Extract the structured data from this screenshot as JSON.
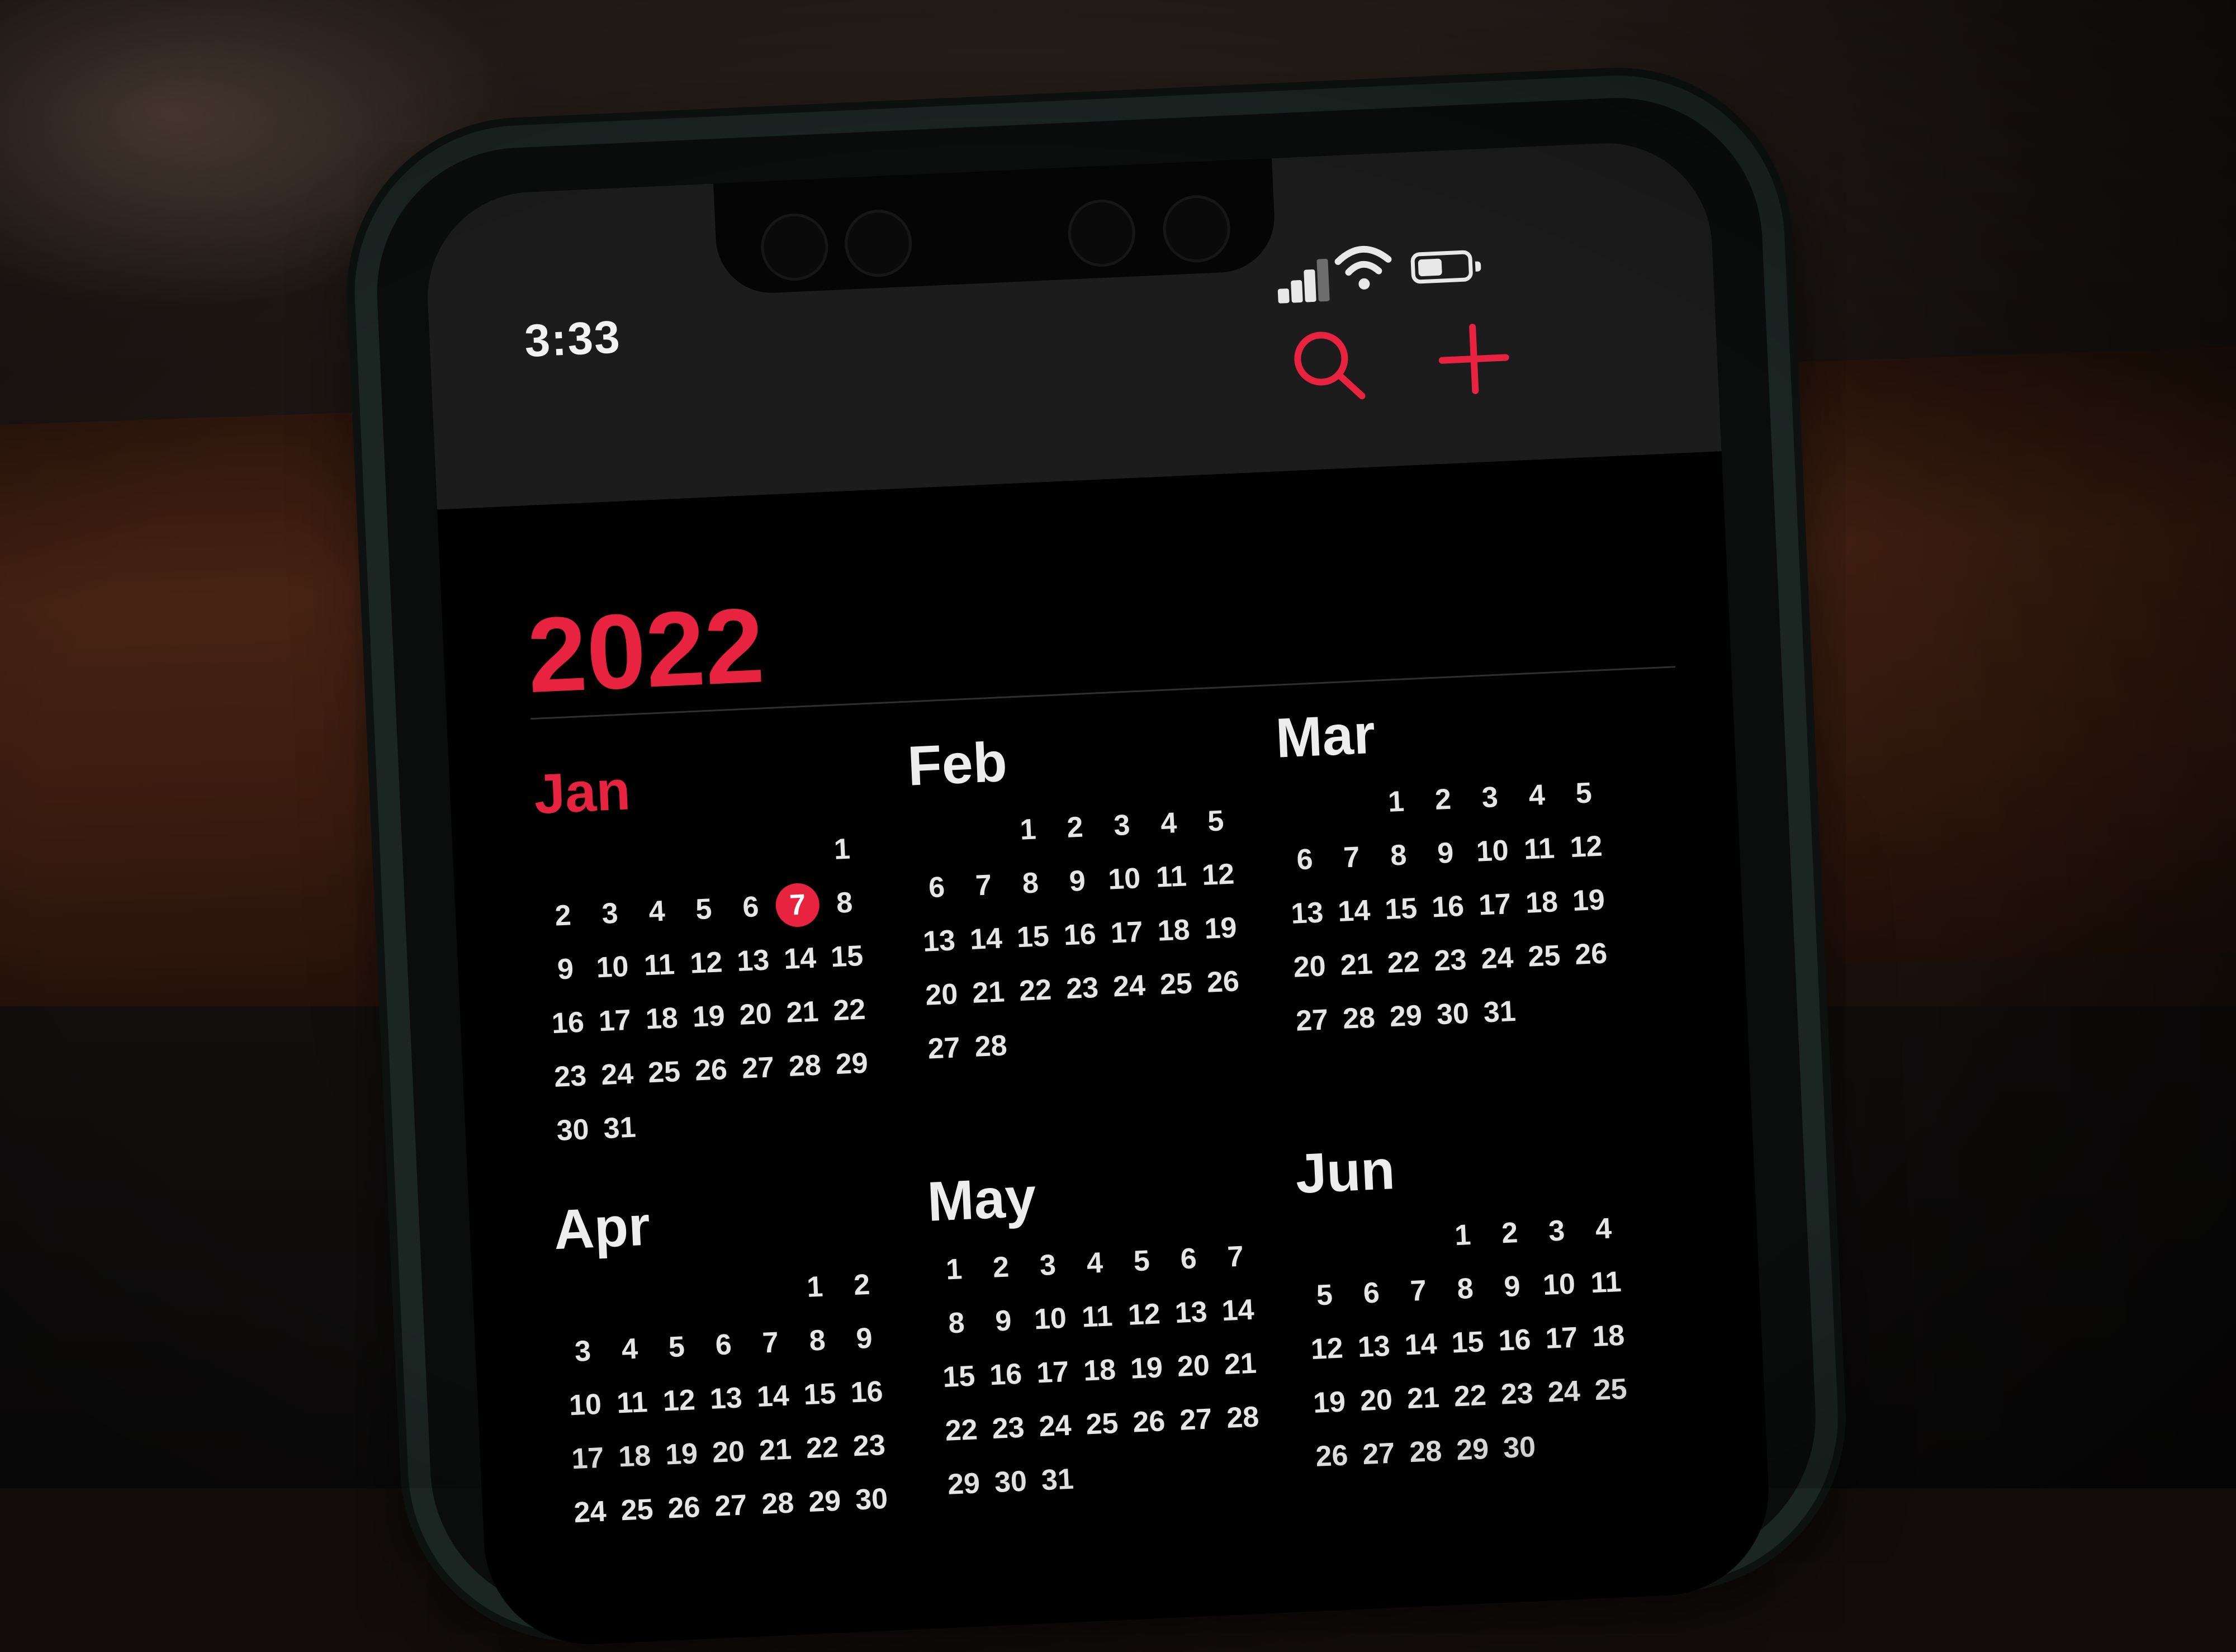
{
  "status_bar": {
    "time": "3:33",
    "icons": [
      "signal-icon",
      "wifi-icon",
      "battery-icon"
    ]
  },
  "toolbar": {
    "icons": [
      "search-icon",
      "add-icon"
    ],
    "accent_color": "#e8233f"
  },
  "year": "2022",
  "today": {
    "month": "Jan",
    "day": 7
  },
  "months": [
    {
      "name": "Jan",
      "current": true,
      "offset": 6,
      "days": 31
    },
    {
      "name": "Feb",
      "current": false,
      "offset": 2,
      "days": 28
    },
    {
      "name": "Mar",
      "current": false,
      "offset": 2,
      "days": 31
    },
    {
      "name": "Apr",
      "current": false,
      "offset": 5,
      "days": 30
    },
    {
      "name": "May",
      "current": false,
      "offset": 0,
      "days": 31
    },
    {
      "name": "Jun",
      "current": false,
      "offset": 3,
      "days": 30
    }
  ]
}
